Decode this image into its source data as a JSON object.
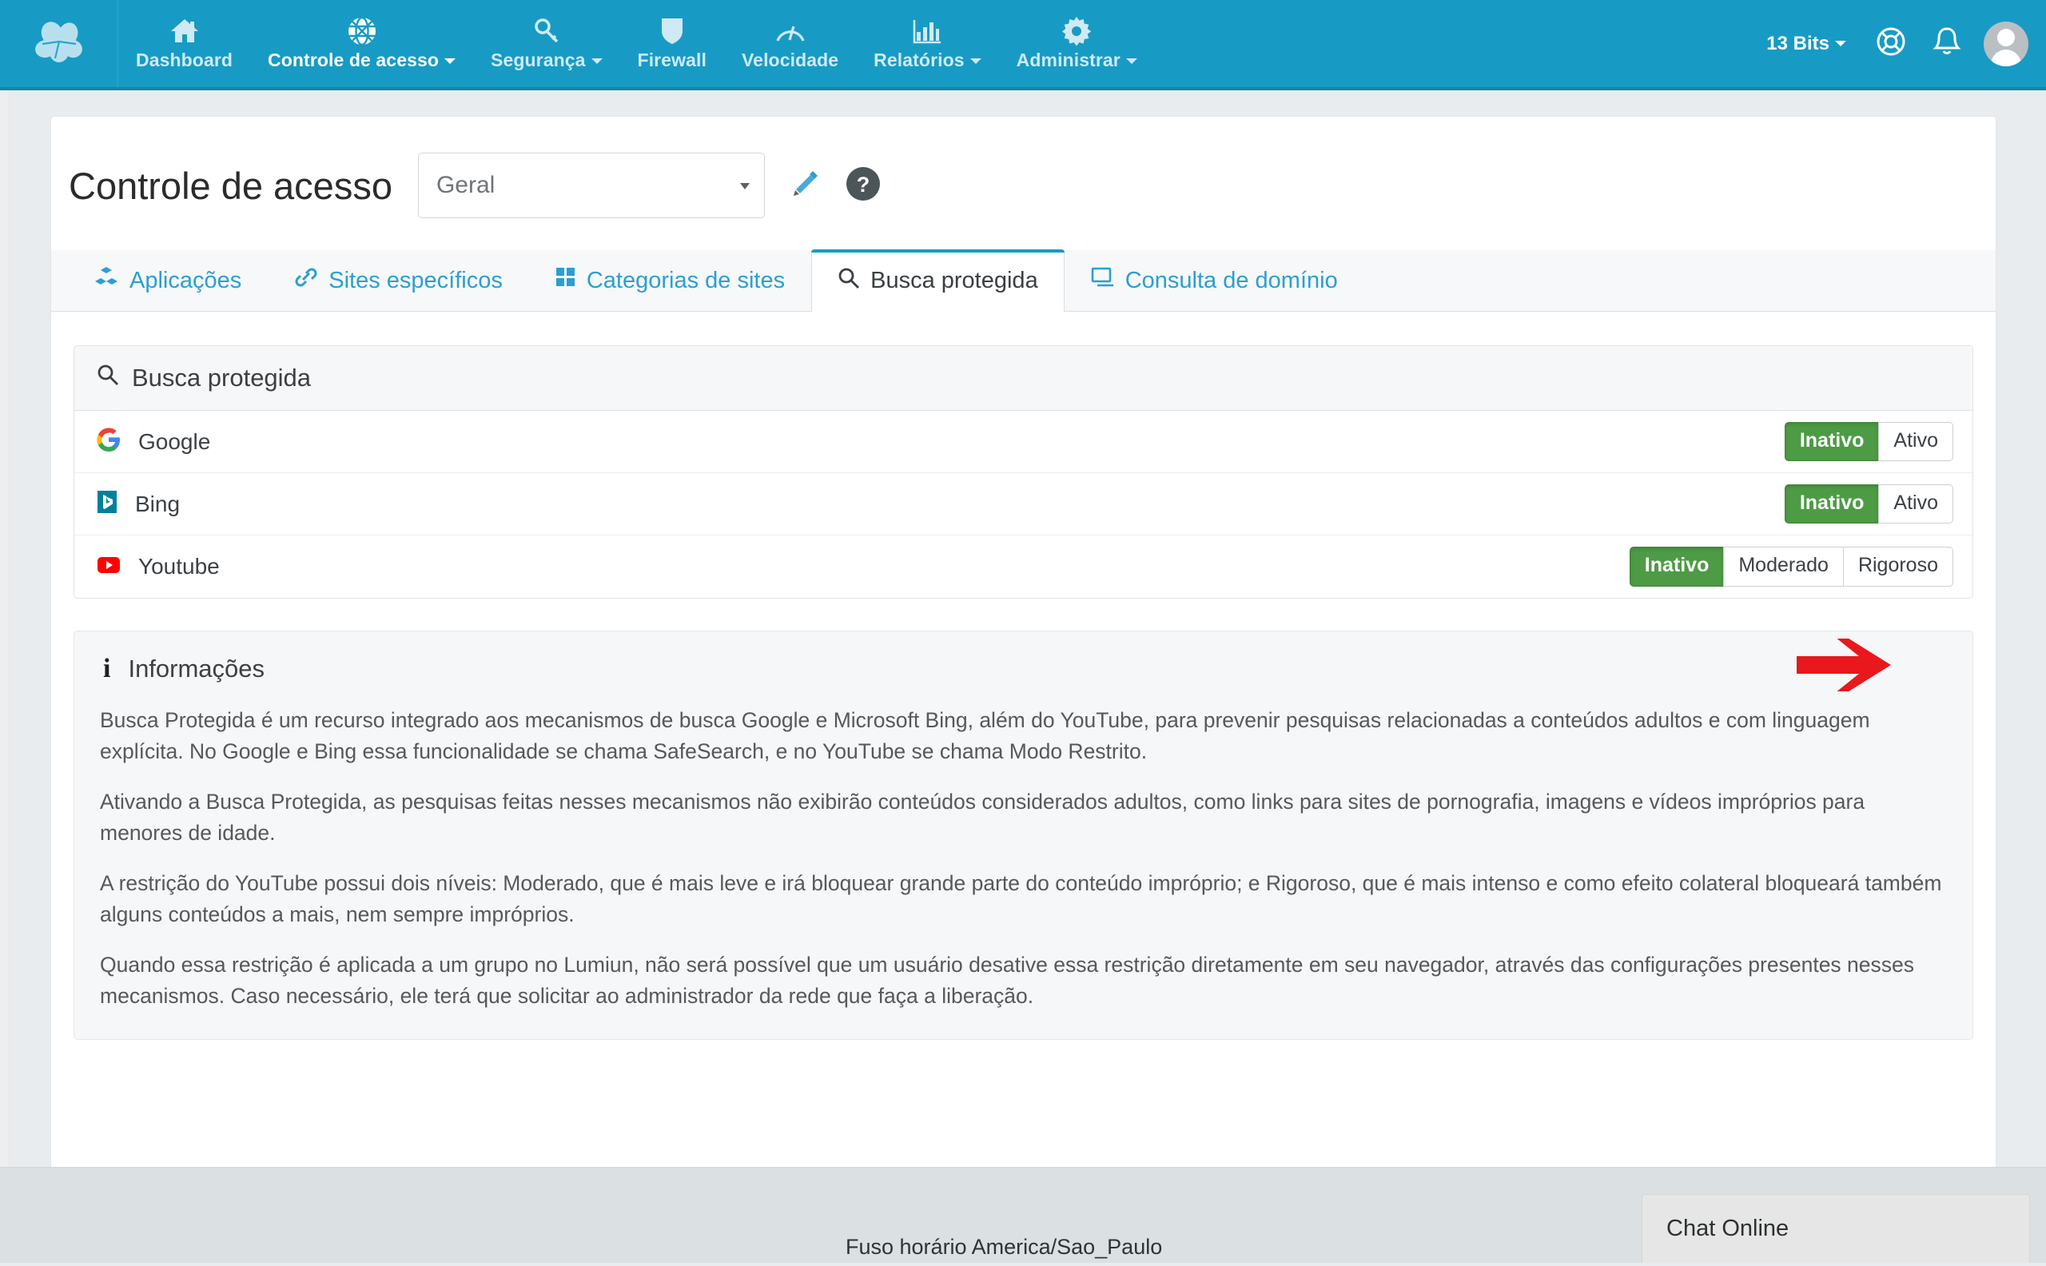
{
  "navbar": {
    "brand_icon": "cloud-logo-icon",
    "items": [
      {
        "label": "Dashboard",
        "icon": "home-icon",
        "caret": false,
        "active": false
      },
      {
        "label": "Controle de acesso",
        "icon": "globe-network-icon",
        "caret": true,
        "active": true
      },
      {
        "label": "Segurança",
        "icon": "key-icon",
        "caret": true,
        "active": false
      },
      {
        "label": "Firewall",
        "icon": "shield-icon",
        "caret": false,
        "active": false
      },
      {
        "label": "Velocidade",
        "icon": "speedometer-icon",
        "caret": false,
        "active": false
      },
      {
        "label": "Relatórios",
        "icon": "bar-chart-icon",
        "caret": true,
        "active": false
      },
      {
        "label": "Administrar",
        "icon": "gear-icon",
        "caret": true,
        "active": false
      }
    ],
    "account_label": "13 Bits",
    "support_icon": "lifebuoy-icon",
    "notification_icon": "bell-icon",
    "avatar_icon": "user-avatar-icon"
  },
  "header": {
    "title": "Controle de acesso",
    "group_select_value": "Geral",
    "edit_icon": "pencil-icon",
    "help_icon": "question-circle-icon"
  },
  "tabs": [
    {
      "label": "Aplicações",
      "icon": "cubes-icon",
      "active": false
    },
    {
      "label": "Sites específicos",
      "icon": "link-icon",
      "active": false
    },
    {
      "label": "Categorias de sites",
      "icon": "grid-squares-icon",
      "active": false
    },
    {
      "label": "Busca protegida",
      "icon": "search-icon",
      "active": true
    },
    {
      "label": "Consulta de domínio",
      "icon": "monitor-icon",
      "active": false
    }
  ],
  "panel": {
    "title": "Busca protegida",
    "title_icon": "search-icon",
    "rows": [
      {
        "name": "Google",
        "icon": "google-g-icon",
        "options": [
          "Inativo",
          "Ativo"
        ],
        "selected": "Inativo",
        "annotated": false
      },
      {
        "name": "Bing",
        "icon": "bing-b-icon",
        "options": [
          "Inativo",
          "Ativo"
        ],
        "selected": "Inativo",
        "annotated": true
      },
      {
        "name": "Youtube",
        "icon": "youtube-play-icon",
        "options": [
          "Inativo",
          "Moderado",
          "Rigoroso"
        ],
        "selected": "Inativo",
        "annotated": false
      }
    ]
  },
  "info": {
    "title": "Informações",
    "title_icon": "info-icon",
    "paragraphs": [
      "Busca Protegida é um recurso integrado aos mecanismos de busca Google e Microsoft Bing, além do YouTube, para prevenir pesquisas relacionadas a conteúdos adultos e com linguagem explícita. No Google e Bing essa funcionalidade se chama SafeSearch, e no YouTube se chama Modo Restrito.",
      "Ativando a Busca Protegida, as pesquisas feitas nesses mecanismos não exibirão conteúdos considerados adultos, como links para sites de pornografia, imagens e vídeos impróprios para menores de idade.",
      "A restrição do YouTube possui dois níveis: Moderado, que é mais leve e irá bloquear grande parte do conteúdo impróprio; e Rigoroso, que é mais intenso e como efeito colateral bloqueará também alguns conteúdos a mais, nem sempre impróprios.",
      "Quando essa restrição é aplicada a um grupo no Lumiun, não será possível que um usuário desative essa restrição diretamente em seu navegador, através das configurações presentes nesses mecanismos. Caso necessário, ele terá que solicitar ao administrador da rede que faça a liberação."
    ]
  },
  "footer": {
    "timezone_text": "Fuso horário America/Sao_Paulo",
    "chat_label": "Chat Online"
  },
  "colors": {
    "navbar_blue": "#179bc4",
    "tab_link_blue": "#2c9fd0",
    "active_green": "#4d9b45",
    "annotation_red": "#e8181c",
    "page_bg": "#e9ecee"
  }
}
